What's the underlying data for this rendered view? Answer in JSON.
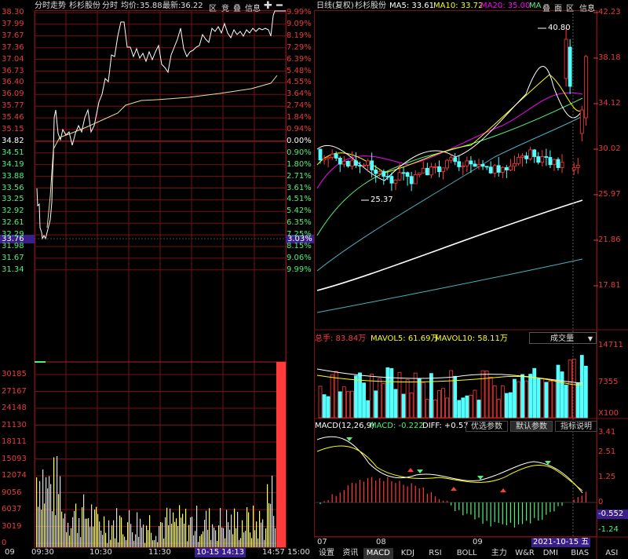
{
  "intraday": {
    "header": {
      "title": "分时走势",
      "stock": "杉杉股份",
      "mode": "分时",
      "avg_label": "均价:",
      "avg_value": "35.88",
      "latest_label": "最新:",
      "latest_value": "36.22",
      "btn_jing": "区",
      "btn_jingjia": "竞",
      "btn_die": "叠",
      "btn_info": "信息"
    },
    "price_ticks": [
      "38.30",
      "37.99",
      "37.67",
      "37.36",
      "37.04",
      "36.73",
      "36.40",
      "36.09",
      "35.77",
      "35.46",
      "35.15",
      "34.82",
      "34.51",
      "34.19",
      "33.88",
      "33.56",
      "33.25",
      "32.92",
      "32.61",
      "32.29",
      "31.98",
      "31.67",
      "31.34"
    ],
    "pct_ticks": [
      "9.99%",
      "9.09%",
      "8.19%",
      "7.29%",
      "6.39%",
      "5.48%",
      "4.55%",
      "3.64%",
      "2.74%",
      "1.84%",
      "0.94%",
      "0.00%",
      "0.90%",
      "1.80%",
      "2.71%",
      "3.61%",
      "4.51%",
      "5.42%",
      "6.35%",
      "7.25%",
      "8.15%",
      "9.06%",
      "9.99%"
    ],
    "cursor_price": "33.76",
    "cursor_pct": "3.03%",
    "volume_ticks": [
      "30185",
      "27167",
      "24148",
      "21130",
      "18111",
      "15093",
      "12074",
      "9056",
      "6037",
      "3019",
      "0"
    ],
    "time_ticks": [
      "09:30",
      "10:30",
      "11:30",
      "14:13",
      "14:57",
      "15:00"
    ],
    "time_left_cut": "09",
    "cursor_time": "10-15 14:13"
  },
  "daily": {
    "header": {
      "title": "日线(复权)",
      "stock": "杉杉股份",
      "ma5": "MA5: 33.61",
      "ma10": "MA10: 33.72",
      "ma20": "MA20: 35.00",
      "ma_more": "MA",
      "btn_die": "叠",
      "btn_mian": "面",
      "btn_qu": "区",
      "btn_info": "信息"
    },
    "price_ticks": [
      "42.23",
      "38.18",
      "34.12",
      "30.02",
      "25.97",
      "21.86",
      "17.81"
    ],
    "high_mark": "40.80",
    "low_mark": "25.37",
    "volume": {
      "total": "总手: 83.84万",
      "mavol5": "MAVOL5: 61.69万",
      "mavol10": "MAVOL10: 58.11万",
      "selector": "成交量",
      "ticks": [
        "14711",
        "7355",
        "X100"
      ]
    },
    "macd": {
      "title": "MACD(12,26,9)",
      "macd_val": "MACD: -0.222",
      "diff_val": "DIFF: +0.57",
      "btn_opt": "优选参数",
      "btn_default": "默认参数",
      "btn_help": "指标说明",
      "ticks": [
        "3.41",
        "2.51",
        "1.25",
        "0",
        "-0.552",
        "-1.24"
      ]
    },
    "date_ticks": [
      "07",
      "08",
      "09"
    ],
    "cursor_date": "2021-10-15 五"
  },
  "tabs": [
    "设置",
    "资讯",
    "MACD",
    "KDJ",
    "RSI",
    "BOLL",
    "主力",
    "W&R",
    "DMI",
    "BIAS",
    "ASI",
    "VR"
  ],
  "active_tab": "MACD",
  "colors": {
    "up": "#ff3b3b",
    "down": "#54ffff",
    "grid": "#7a1010",
    "ma5": "#ffffff",
    "ma10": "#ffff00",
    "ma20": "#ff00ff",
    "cursor": "#3a1f8c"
  }
}
